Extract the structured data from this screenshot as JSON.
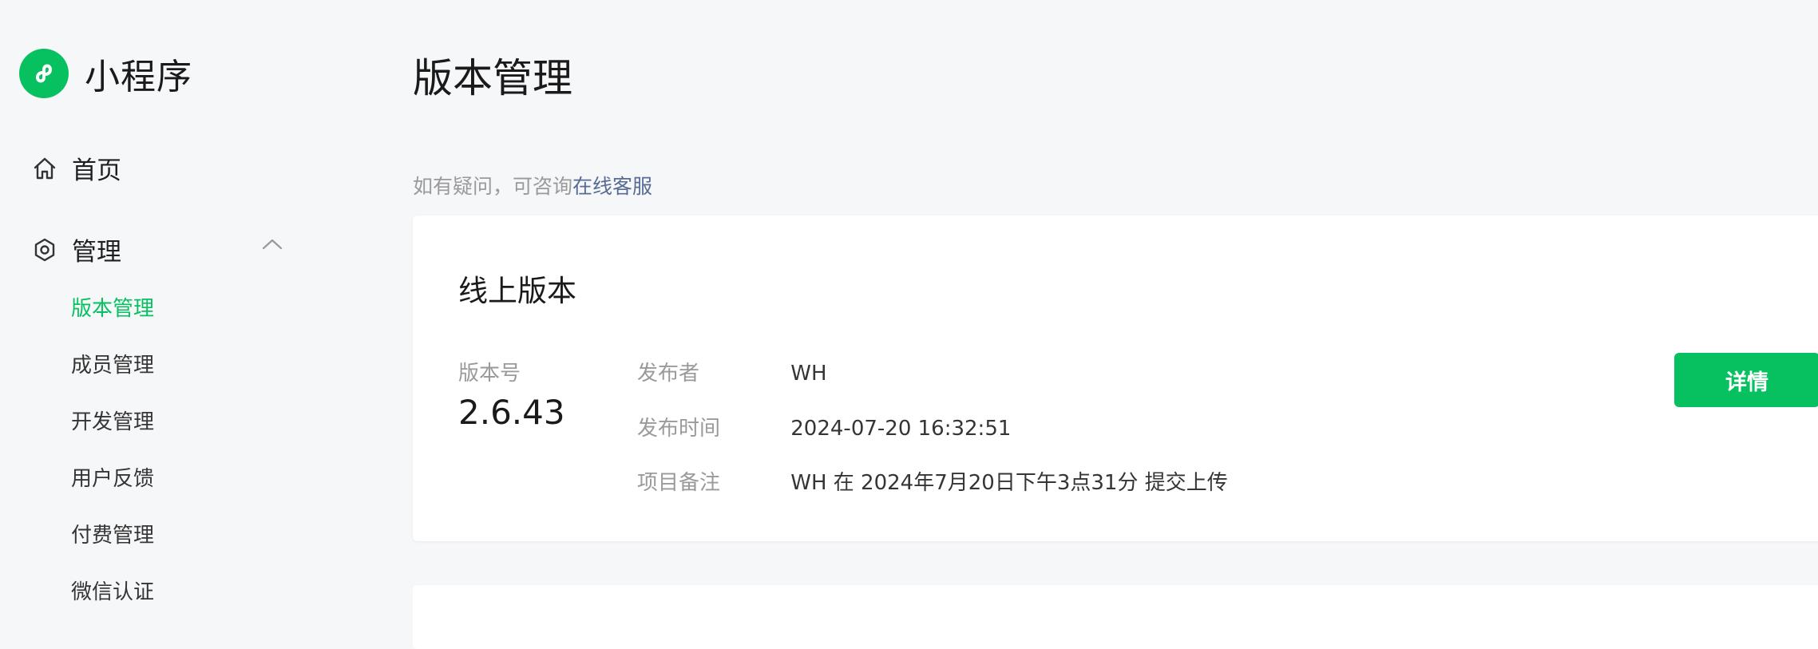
{
  "app": {
    "name": "小程序",
    "brand_color": "#07c160"
  },
  "sidebar": {
    "home_label": "首页",
    "manage_label": "管理",
    "sub_items": [
      {
        "label": "版本管理",
        "active": true
      },
      {
        "label": "成员管理",
        "active": false
      },
      {
        "label": "开发管理",
        "active": false
      },
      {
        "label": "用户反馈",
        "active": false
      },
      {
        "label": "付费管理",
        "active": false
      },
      {
        "label": "微信认证",
        "active": false
      }
    ]
  },
  "main": {
    "page_title": "版本管理",
    "help_prefix": "如有疑问，可咨询",
    "help_link": "在线客服",
    "online_version": {
      "title": "线上版本",
      "version_label": "版本号",
      "version": "2.6.43",
      "publisher_label": "发布者",
      "publisher": "WH",
      "publish_time_label": "发布时间",
      "publish_time": "2024-07-20 16:32:51",
      "note_label": "项目备注",
      "note": "WH 在 2024年7月20日下午3点31分 提交上传",
      "detail_button": "详情"
    }
  },
  "icons": {
    "logo": "mini-program-logo-icon",
    "home": "home-icon",
    "manage": "hexagon-settings-icon",
    "collapse": "chevron-up-icon"
  }
}
